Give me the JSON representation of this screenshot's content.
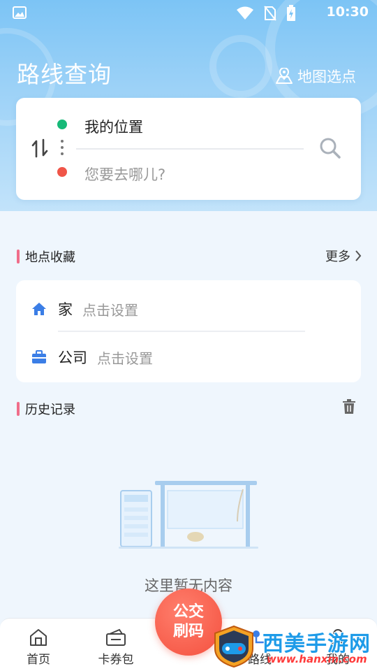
{
  "status_bar": {
    "time": "10:30"
  },
  "header": {
    "title": "路线查询",
    "map_pick_label": "地图选点"
  },
  "search": {
    "from_label": "我的位置",
    "to_placeholder": "您要去哪儿?"
  },
  "favorites": {
    "title": "地点收藏",
    "more_label": "更多",
    "items": [
      {
        "label": "家",
        "hint": "点击设置"
      },
      {
        "label": "公司",
        "hint": "点击设置"
      }
    ]
  },
  "history": {
    "title": "历史记录",
    "empty_text": "这里暂无内容"
  },
  "bottom_nav": {
    "items": [
      {
        "label": "首页"
      },
      {
        "label": "卡券包"
      },
      {
        "label": "路线"
      },
      {
        "label": "我的"
      }
    ],
    "fab_line1": "公交",
    "fab_line2": "刷码"
  },
  "watermark": {
    "title": "西美手游网",
    "url": "www.hanxm.com"
  },
  "colors": {
    "header_blue": "#7cc4f5",
    "origin_green": "#17b978",
    "destination_red": "#f05548",
    "section_bar_pink": "#f06d8a",
    "fab_red": "#f4503e",
    "icon_blue": "#3b7ee6"
  }
}
